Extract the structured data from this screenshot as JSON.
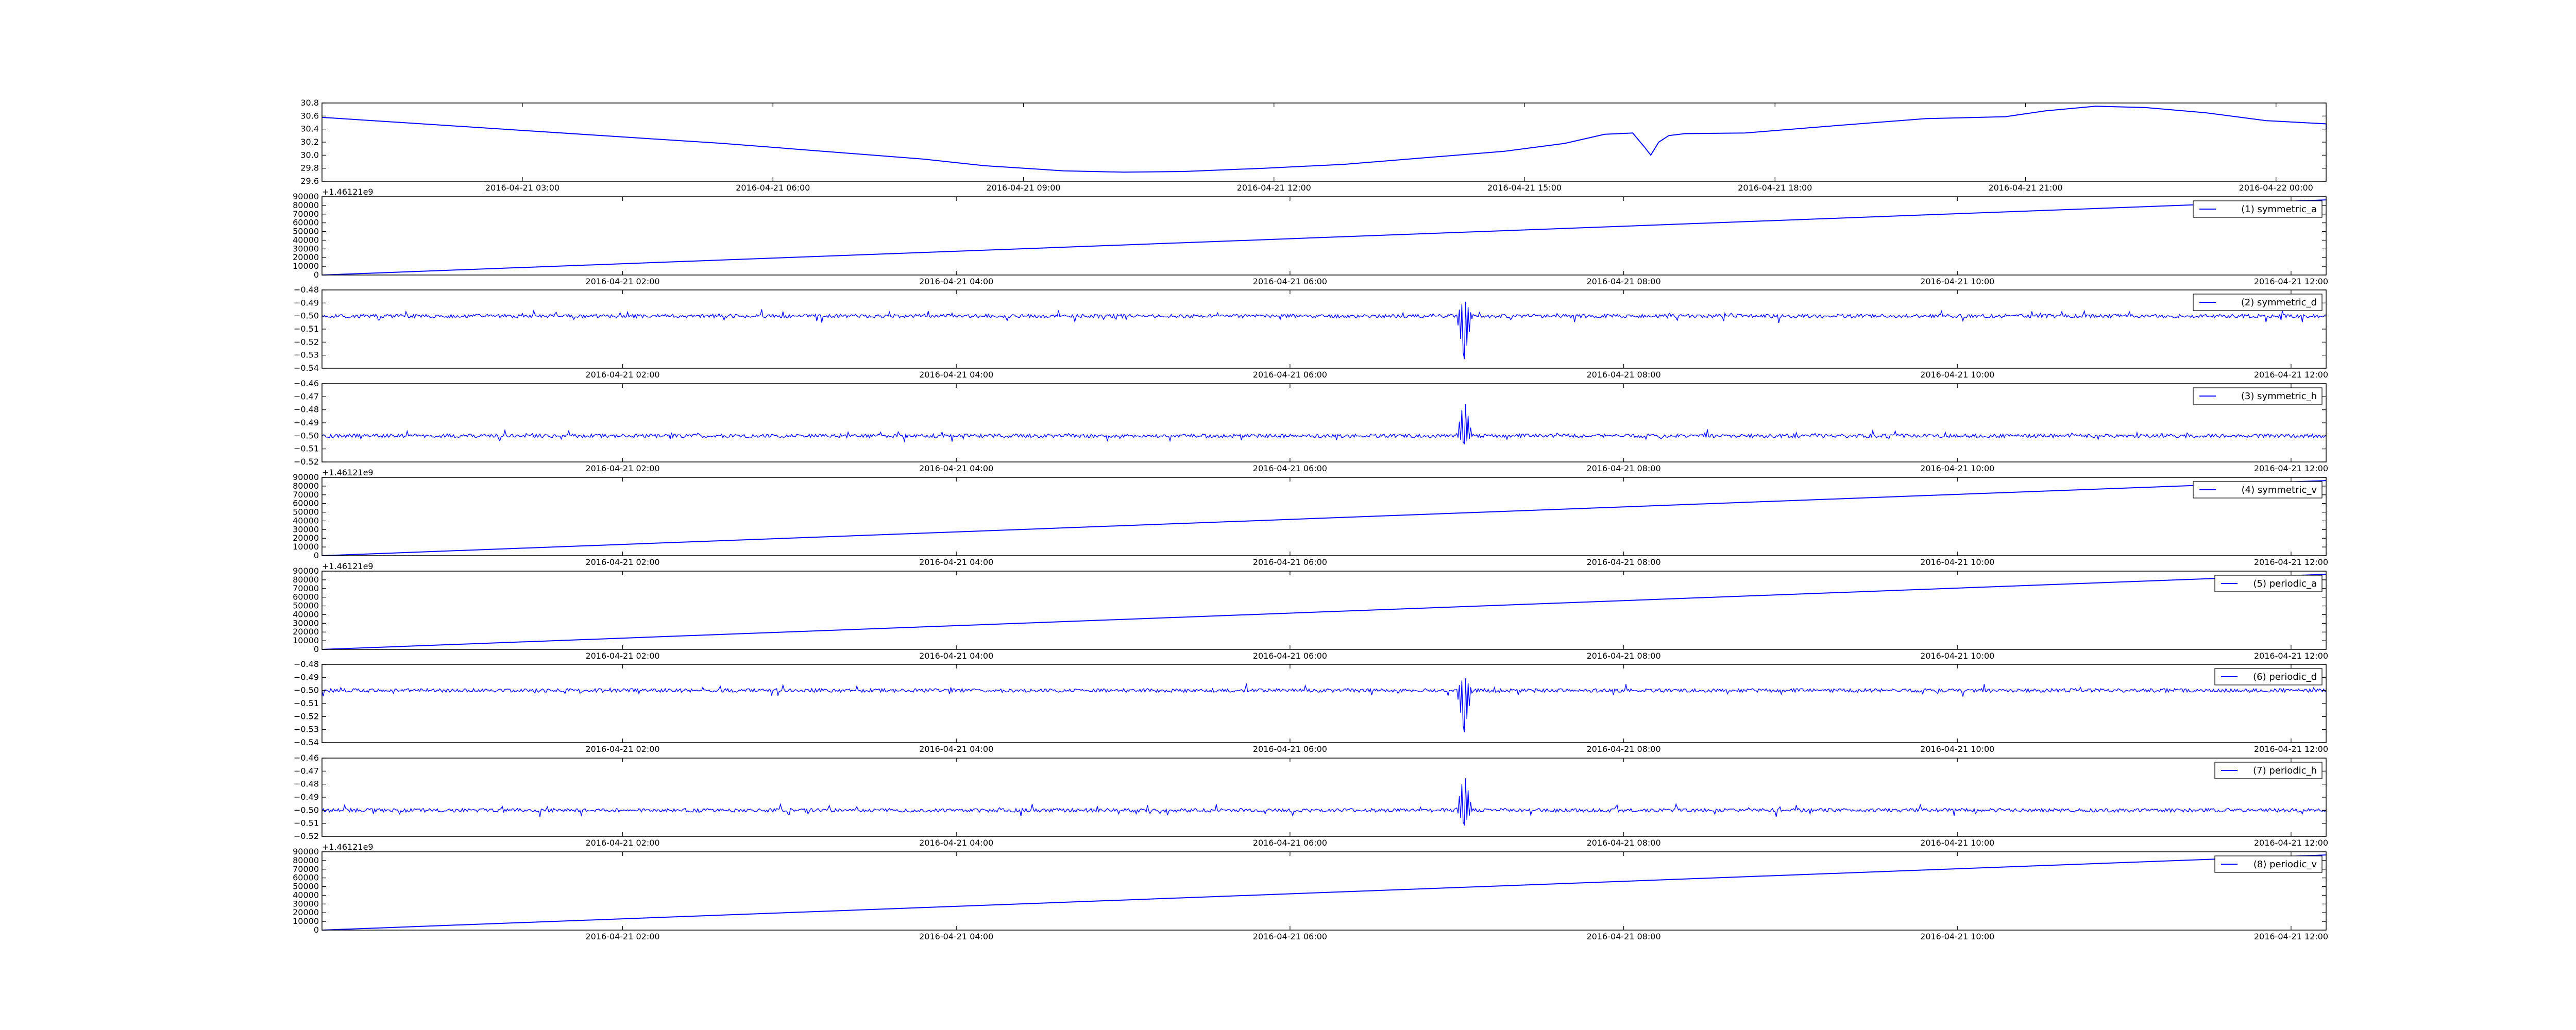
{
  "chart_data": [
    {
      "type": "line",
      "ylim": [
        29.6,
        30.8
      ],
      "y_ticks": [
        "29.6",
        "29.8",
        "30.0",
        "30.2",
        "30.4",
        "30.6",
        "30.8"
      ],
      "x_ticks": [
        "2016-04-21 03:00",
        "2016-04-21 06:00",
        "2016-04-21 09:00",
        "2016-04-21 12:00",
        "2016-04-21 15:00",
        "2016-04-21 18:00",
        "2016-04-21 21:00",
        "2016-04-22 00:00"
      ],
      "series": [
        {
          "color": "#0000ff",
          "points": [
            [
              0,
              30.58
            ],
            [
              0.05,
              30.48
            ],
            [
              0.1,
              30.38
            ],
            [
              0.15,
              30.28
            ],
            [
              0.2,
              30.18
            ],
            [
              0.25,
              30.06
            ],
            [
              0.3,
              29.94
            ],
            [
              0.33,
              29.84
            ],
            [
              0.37,
              29.76
            ],
            [
              0.4,
              29.74
            ],
            [
              0.43,
              29.75
            ],
            [
              0.47,
              29.8
            ],
            [
              0.51,
              29.86
            ],
            [
              0.55,
              29.96
            ],
            [
              0.59,
              30.06
            ],
            [
              0.62,
              30.18
            ],
            [
              0.64,
              30.32
            ],
            [
              0.654,
              30.34
            ],
            [
              0.66,
              30.12
            ],
            [
              0.663,
              30.0
            ],
            [
              0.667,
              30.2
            ],
            [
              0.672,
              30.3
            ],
            [
              0.68,
              30.33
            ],
            [
              0.71,
              30.34
            ],
            [
              0.75,
              30.44
            ],
            [
              0.8,
              30.56
            ],
            [
              0.84,
              30.59
            ],
            [
              0.86,
              30.68
            ],
            [
              0.885,
              30.75
            ],
            [
              0.91,
              30.73
            ],
            [
              0.94,
              30.65
            ],
            [
              0.97,
              30.53
            ],
            [
              1.0,
              30.48
            ],
            [
              1.05,
              30.4
            ]
          ]
        }
      ]
    },
    {
      "type": "line",
      "ylim": [
        0,
        90000
      ],
      "y_ticks": [
        "0",
        "10000",
        "20000",
        "30000",
        "40000",
        "50000",
        "60000",
        "70000",
        "80000",
        "90000"
      ],
      "y_offset_text": "+1.46121e9",
      "x_ticks": [
        "2016-04-21 02:00",
        "2016-04-21 04:00",
        "2016-04-21 06:00",
        "2016-04-21 08:00",
        "2016-04-21 10:00",
        "2016-04-21 12:00"
      ],
      "legend": "(1) symmetric_a",
      "series": [
        {
          "name": "(1) symmetric_a",
          "color": "#0000ff",
          "points": [
            [
              0,
              0
            ],
            [
              1,
              86400
            ]
          ]
        }
      ]
    },
    {
      "type": "line",
      "ylim": [
        -0.54,
        -0.48
      ],
      "y_ticks": [
        "−0.54",
        "−0.53",
        "−0.52",
        "−0.51",
        "−0.50",
        "−0.49",
        "−0.48"
      ],
      "x_ticks": [
        "2016-04-21 02:00",
        "2016-04-21 04:00",
        "2016-04-21 06:00",
        "2016-04-21 08:00",
        "2016-04-21 10:00",
        "2016-04-21 12:00"
      ],
      "legend": "(2) symmetric_d",
      "series": [
        {
          "name": "(2) symmetric_d",
          "color": "#0000ff",
          "baseline": -0.5,
          "noise": 0.0014,
          "spike_at": 0.57,
          "spike_min": -0.533,
          "spike_max": -0.487
        }
      ]
    },
    {
      "type": "line",
      "ylim": [
        -0.52,
        -0.46
      ],
      "y_ticks": [
        "−0.52",
        "−0.51",
        "−0.50",
        "−0.49",
        "−0.48",
        "−0.47",
        "−0.46"
      ],
      "x_ticks": [
        "2016-04-21 02:00",
        "2016-04-21 04:00",
        "2016-04-21 06:00",
        "2016-04-21 08:00",
        "2016-04-21 10:00",
        "2016-04-21 12:00"
      ],
      "legend": "(3) symmetric_h",
      "series": [
        {
          "name": "(3) symmetric_h",
          "color": "#0000ff",
          "baseline": -0.5,
          "noise": 0.0014,
          "spike_at": 0.57,
          "spike_min": -0.506,
          "spike_max": -0.471
        }
      ]
    },
    {
      "type": "line",
      "ylim": [
        0,
        90000
      ],
      "y_ticks": [
        "0",
        "10000",
        "20000",
        "30000",
        "40000",
        "50000",
        "60000",
        "70000",
        "80000",
        "90000"
      ],
      "y_offset_text": "+1.46121e9",
      "x_ticks": [
        "2016-04-21 02:00",
        "2016-04-21 04:00",
        "2016-04-21 06:00",
        "2016-04-21 08:00",
        "2016-04-21 10:00",
        "2016-04-21 12:00"
      ],
      "legend": "(4) symmetric_v",
      "series": [
        {
          "name": "(4) symmetric_v",
          "color": "#0000ff",
          "points": [
            [
              0,
              0
            ],
            [
              1,
              86400
            ]
          ]
        }
      ]
    },
    {
      "type": "line",
      "ylim": [
        0,
        90000
      ],
      "y_ticks": [
        "0",
        "10000",
        "20000",
        "30000",
        "40000",
        "50000",
        "60000",
        "70000",
        "80000",
        "90000"
      ],
      "y_offset_text": "+1.46121e9",
      "x_ticks": [
        "2016-04-21 02:00",
        "2016-04-21 04:00",
        "2016-04-21 06:00",
        "2016-04-21 08:00",
        "2016-04-21 10:00",
        "2016-04-21 12:00"
      ],
      "legend": "(5) periodic_a",
      "series": [
        {
          "name": "(5) periodic_a",
          "color": "#0000ff",
          "points": [
            [
              0,
              0
            ],
            [
              1,
              86400
            ]
          ]
        }
      ]
    },
    {
      "type": "line",
      "ylim": [
        -0.54,
        -0.48
      ],
      "y_ticks": [
        "−0.54",
        "−0.53",
        "−0.52",
        "−0.51",
        "−0.50",
        "−0.49",
        "−0.48"
      ],
      "x_ticks": [
        "2016-04-21 02:00",
        "2016-04-21 04:00",
        "2016-04-21 06:00",
        "2016-04-21 08:00",
        "2016-04-21 10:00",
        "2016-04-21 12:00"
      ],
      "legend": "(6) periodic_d",
      "series": [
        {
          "name": "(6) periodic_d",
          "color": "#0000ff",
          "baseline": -0.5,
          "noise": 0.0014,
          "spike_at": 0.57,
          "spike_min": -0.532,
          "spike_max": -0.489
        }
      ]
    },
    {
      "type": "line",
      "ylim": [
        -0.52,
        -0.46
      ],
      "y_ticks": [
        "−0.52",
        "−0.51",
        "−0.50",
        "−0.49",
        "−0.48",
        "−0.47",
        "−0.46"
      ],
      "x_ticks": [
        "2016-04-21 02:00",
        "2016-04-21 04:00",
        "2016-04-21 06:00",
        "2016-04-21 08:00",
        "2016-04-21 10:00",
        "2016-04-21 12:00"
      ],
      "legend": "(7) periodic_h",
      "series": [
        {
          "name": "(7) periodic_h",
          "color": "#0000ff",
          "baseline": -0.5,
          "noise": 0.0014,
          "spike_at": 0.57,
          "spike_min": -0.511,
          "spike_max": -0.471
        }
      ]
    },
    {
      "type": "line",
      "ylim": [
        0,
        90000
      ],
      "y_ticks": [
        "0",
        "10000",
        "20000",
        "30000",
        "40000",
        "50000",
        "60000",
        "70000",
        "80000",
        "90000"
      ],
      "y_offset_text": "+1.46121e9",
      "x_ticks": [
        "2016-04-21 02:00",
        "2016-04-21 04:00",
        "2016-04-21 06:00",
        "2016-04-21 08:00",
        "2016-04-21 10:00",
        "2016-04-21 12:00"
      ],
      "legend": "(8) periodic_v",
      "series": [
        {
          "name": "(8) periodic_v",
          "color": "#0000ff",
          "points": [
            [
              0,
              0
            ],
            [
              1,
              86400
            ]
          ]
        }
      ]
    }
  ]
}
